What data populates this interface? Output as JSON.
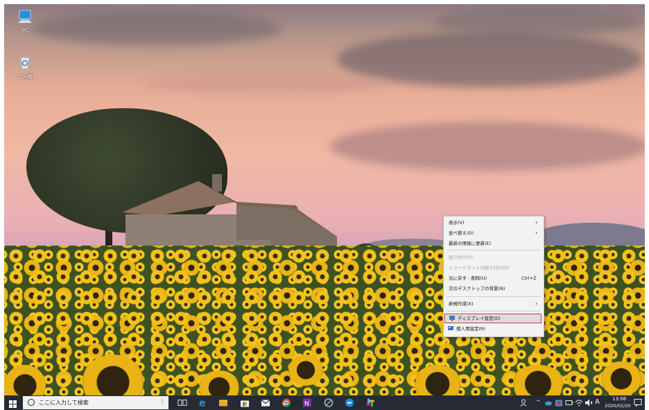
{
  "desktop": {
    "icons": [
      {
        "label": "PC"
      },
      {
        "label": "ごみ箱"
      }
    ]
  },
  "context_menu": {
    "items": [
      {
        "label": "表示(V)",
        "submenu": true,
        "disabled": false
      },
      {
        "label": "並べ替え(O)",
        "submenu": true,
        "disabled": false
      },
      {
        "label": "最新の情報に更新(E)",
        "submenu": false,
        "disabled": false
      },
      {
        "label": "貼り付け(P)",
        "submenu": false,
        "disabled": true
      },
      {
        "label": "ショートカットの貼り付け(S)",
        "submenu": false,
        "disabled": true
      },
      {
        "label": "元に戻す - 削除(U)",
        "shortcut": "Ctrl+Z",
        "disabled": false
      },
      {
        "label": "次のデスクトップの背景(N)",
        "disabled": false
      },
      {
        "label": "新規作成(X)",
        "submenu": true,
        "disabled": false
      },
      {
        "label": "ディスプレイ設定(D)",
        "icon": "display-settings-icon",
        "highlighted": true
      },
      {
        "label": "個人用設定(R)",
        "icon": "personalize-icon",
        "highlighted": false
      }
    ],
    "highlight_color": "#d23c3c"
  },
  "taskbar": {
    "search_placeholder": "ここに入力して検索",
    "apps": [
      "microphone-icon",
      "task-view-icon",
      "edge-icon",
      "file-explorer-icon",
      "store-icon",
      "mail-icon",
      "chrome-icon",
      "onenote-icon",
      "app-icon",
      "teams-icon",
      "slack-icon"
    ],
    "tray": {
      "ime": "A",
      "time": "13:06",
      "date": "2020/02/20"
    }
  }
}
